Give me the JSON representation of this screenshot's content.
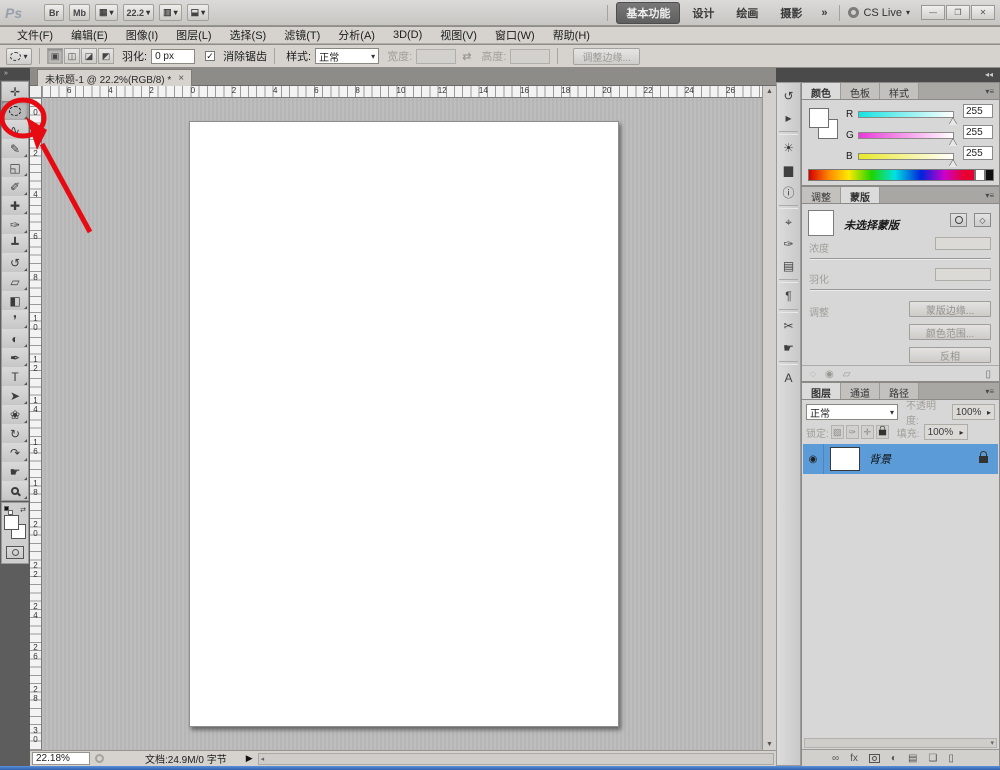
{
  "colors": {
    "accent_blue": "#5b9cd8",
    "annotation_red": "#e60b12",
    "chrome_gray": "#d6d3ce",
    "dark_strip": "#4a4a4a",
    "pasteboard_gray": "#bababa",
    "taskbar_blue": "#3f6fc4"
  },
  "app_bar": {
    "logo": "Ps",
    "bridge": "Br",
    "mini_bridge": "Mb",
    "arrange_icon": "▦",
    "zoom": "22.2",
    "view_extras_icon": "▥",
    "screen_mode_icon": "⬓",
    "caret": "▾",
    "workspaces": [
      {
        "name": "workspace-essentials",
        "label": "基本功能",
        "cls": "active"
      },
      {
        "name": "workspace-design",
        "label": "设计"
      },
      {
        "name": "workspace-painting",
        "label": "绘画"
      },
      {
        "name": "workspace-photography",
        "label": "摄影"
      }
    ],
    "workspace_overflow": "»",
    "cs_live": "CS Live",
    "window_buttons": [
      {
        "name": "minimize-button",
        "glyph": "—"
      },
      {
        "name": "restore-button",
        "glyph": "❐"
      },
      {
        "name": "close-button",
        "glyph": "✕"
      }
    ]
  },
  "menu_bar": {
    "items": [
      "文件(F)",
      "编辑(E)",
      "图像(I)",
      "图层(L)",
      "选择(S)",
      "滤镜(T)",
      "分析(A)",
      "3D(D)",
      "视图(V)",
      "窗口(W)",
      "帮助(H)"
    ]
  },
  "options_bar": {
    "modes": [
      {
        "name": "new-selection-mode",
        "glyph": "▣",
        "cls": "pressed"
      },
      {
        "name": "add-selection-mode",
        "glyph": "◫"
      },
      {
        "name": "subtract-selection-mode",
        "glyph": "◪"
      },
      {
        "name": "intersect-selection-mode",
        "glyph": "◩"
      }
    ],
    "feather_label": "羽化:",
    "feather_value": "0 px",
    "antialias_check": "✓",
    "antialias_label": "消除锯齿",
    "style_label": "样式:",
    "style_value": "正常",
    "width_label": "宽度:",
    "swap_icon": "⇄",
    "height_label": "高度:",
    "refine_edge": "调整边缘..."
  },
  "toolbar": {
    "collapse": "»",
    "tools": [
      {
        "name": "move-tool",
        "glyph": "✛"
      },
      {
        "name": "elliptical-marquee-tool",
        "glyph": "",
        "cls": "sel"
      },
      {
        "name": "lasso-tool",
        "glyph": "∿"
      },
      {
        "name": "quick-selection-tool",
        "glyph": "✎"
      },
      {
        "name": "crop-tool",
        "glyph": "◱"
      },
      {
        "name": "eyedropper-tool",
        "glyph": "✐"
      },
      {
        "name": "healing-brush-tool",
        "glyph": "✚"
      },
      {
        "name": "brush-tool",
        "glyph": "✑"
      },
      {
        "name": "clone-stamp-tool",
        "glyph": "┻"
      },
      {
        "name": "history-brush-tool",
        "glyph": "↺"
      },
      {
        "name": "eraser-tool",
        "glyph": "▱"
      },
      {
        "name": "gradient-tool",
        "glyph": "◧"
      },
      {
        "name": "blur-tool",
        "glyph": "❜"
      },
      {
        "name": "dodge-tool",
        "glyph": "◐"
      },
      {
        "name": "pen-tool",
        "glyph": "✒"
      },
      {
        "name": "type-tool",
        "glyph": "T"
      },
      {
        "name": "path-selection-tool",
        "glyph": "➤"
      },
      {
        "name": "custom-shape-tool",
        "glyph": "❀"
      },
      {
        "name": "3d-rotate-tool",
        "glyph": "↻"
      },
      {
        "name": "3d-orbit-tool",
        "glyph": "↷"
      },
      {
        "name": "hand-tool",
        "glyph": "☛"
      },
      {
        "name": "zoom-tool",
        "glyph": "",
        "cls": "magt"
      }
    ]
  },
  "document": {
    "tab_title": "未标题-1 @ 22.2%(RGB/8) *",
    "tab_close": "×",
    "top_ruler": [
      "6",
      "4",
      "2",
      "0",
      "2",
      "4",
      "6",
      "8",
      "10",
      "12",
      "14",
      "16",
      "18",
      "20",
      "22",
      "24",
      "26"
    ],
    "left_ruler": [
      "0",
      "2",
      "4",
      "6",
      "8",
      "10",
      "12",
      "14",
      "16",
      "18",
      "20",
      "22",
      "24",
      "26",
      "28",
      "30"
    ],
    "status_zoom": "22.18%",
    "status_doc": "文档:24.9M/0 字节",
    "status_arrow": "▶",
    "scroll_up": "▲",
    "scroll_down": "▼",
    "scroll_left": "◂"
  },
  "dock": {
    "collapse_right": "◂◂",
    "icon_strip": [
      {
        "name": "history-panel-icon",
        "glyph": "↺"
      },
      {
        "name": "actions-panel-icon",
        "glyph": "▸"
      },
      {
        "cls": "div"
      },
      {
        "name": "adjustments-panel-icon",
        "glyph": "☀"
      },
      {
        "name": "histogram-panel-icon",
        "glyph": "▆"
      },
      {
        "name": "info-panel-icon",
        "glyph": "ⓘ"
      },
      {
        "cls": "div"
      },
      {
        "name": "clone-source-panel-icon",
        "glyph": "⌖"
      },
      {
        "name": "brush-panel-icon",
        "glyph": "✑"
      },
      {
        "name": "tool-presets-panel-icon",
        "glyph": "▤"
      },
      {
        "cls": "div"
      },
      {
        "name": "paragraph-panel-icon",
        "glyph": "¶"
      },
      {
        "cls": "div"
      },
      {
        "name": "notes-panel-icon",
        "glyph": "✂"
      },
      {
        "name": "layer-comps-panel-icon",
        "glyph": "☛"
      },
      {
        "cls": "div"
      },
      {
        "name": "character-panel-icon",
        "glyph": "A"
      }
    ]
  },
  "color_panel": {
    "tabs": [
      {
        "name": "tab-color",
        "label": "颜色",
        "cls": "active"
      },
      {
        "name": "tab-swatches",
        "label": "色板"
      },
      {
        "name": "tab-styles",
        "label": "样式"
      }
    ],
    "menu_icon": "▾≡",
    "r_label": "R",
    "r_value": "255",
    "g_label": "G",
    "g_value": "255",
    "b_label": "B",
    "b_value": "255"
  },
  "masks_panel": {
    "tabs": [
      {
        "name": "tab-adjustments",
        "label": "调整"
      },
      {
        "name": "tab-masks",
        "label": "蒙版",
        "cls": "active"
      }
    ],
    "menu_icon": "▾≡",
    "no_mask": "未选择蒙版",
    "density_label": "浓度",
    "feather_label": "羽化",
    "refine_label": "调整",
    "mask_edge_button": "蒙版边缘...",
    "color_range_button": "颜色范围...",
    "invert_button": "反相",
    "foot_icons": [
      "◌",
      "◉",
      "▱"
    ],
    "foot_right_icon": "▯"
  },
  "layers_panel": {
    "tabs": [
      {
        "name": "tab-layers",
        "label": "图层",
        "cls": "active"
      },
      {
        "name": "tab-channels",
        "label": "通道"
      },
      {
        "name": "tab-paths",
        "label": "路径"
      }
    ],
    "menu_icon": "▾≡",
    "blend_mode": "正常",
    "blend_caret": "▾",
    "opacity_label": "不透明度:",
    "opacity_value": "100%",
    "spin_caret": "▸",
    "lock_label": "锁定:",
    "lock_icons": [
      "▨",
      "✑",
      "✛"
    ],
    "fill_label": "填充:",
    "fill_value": "100%",
    "eye_icon": "◉",
    "layer_name": "背景",
    "scroll_caret": "▾",
    "foot_link": "∞",
    "foot_fx": "fx",
    "foot_adjust": "◐",
    "foot_group": "▤",
    "foot_new": "❏",
    "foot_trash": "▯"
  }
}
